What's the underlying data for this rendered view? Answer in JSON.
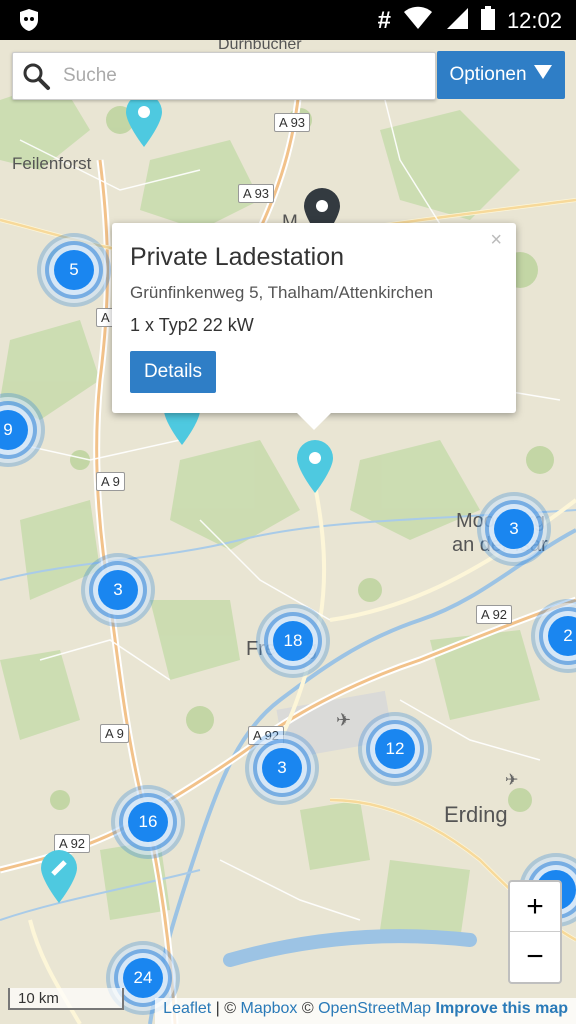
{
  "status_bar": {
    "time": "12:02",
    "icons": [
      "app-shield-icon",
      "hash-icon",
      "wifi-icon",
      "signal-icon",
      "battery-icon"
    ]
  },
  "search": {
    "placeholder": "Suche",
    "value": ""
  },
  "options_button": {
    "label": "Optionen"
  },
  "popup": {
    "title": "Private Ladestation",
    "address": "Grünfinkenweg 5, Thalham/Attenkirchen",
    "plug": "1 x Typ2 22 kW",
    "details_label": "Details",
    "close_label": "×"
  },
  "clusters": [
    {
      "id": "c5",
      "count": "5"
    },
    {
      "id": "c9",
      "count": "9"
    },
    {
      "id": "c3a",
      "count": "3"
    },
    {
      "id": "c3b",
      "count": "3"
    },
    {
      "id": "c2",
      "count": "2"
    },
    {
      "id": "c18",
      "count": "18"
    },
    {
      "id": "c12",
      "count": "12"
    },
    {
      "id": "c3c",
      "count": "3"
    },
    {
      "id": "c16",
      "count": "16"
    },
    {
      "id": "c24",
      "count": "24"
    },
    {
      "id": "c1",
      "count": "1"
    }
  ],
  "places": {
    "duernbucher": "Dürnbucher",
    "feilenforst": "Feilenforst",
    "moosburg": "Moosburg",
    "an_der_isar": "an der Isar",
    "freising": "Freising",
    "erding": "Erding",
    "mainburg": "M"
  },
  "roads": {
    "a93_top": "A 93",
    "a93_mid": "A 93",
    "a9_1": "A",
    "a9_2": "A 9",
    "a9_3": "A 9",
    "a92_right": "A 92",
    "a92_mid": "A 92",
    "a92_left": "A 92"
  },
  "zoom": {
    "in_label": "+",
    "out_label": "−"
  },
  "scale": {
    "label": "10 km"
  },
  "attribution": {
    "leaflet": "Leaflet",
    "sep1": " | © ",
    "mapbox": "Mapbox",
    "sep2": " © ",
    "osm": "OpenStreetMap",
    "improve": "Improve this map"
  },
  "colors": {
    "accent": "#2f7ec6",
    "cluster": "#1a86f0",
    "pin": "#4ec9e0",
    "pin_dark": "#333a40"
  }
}
